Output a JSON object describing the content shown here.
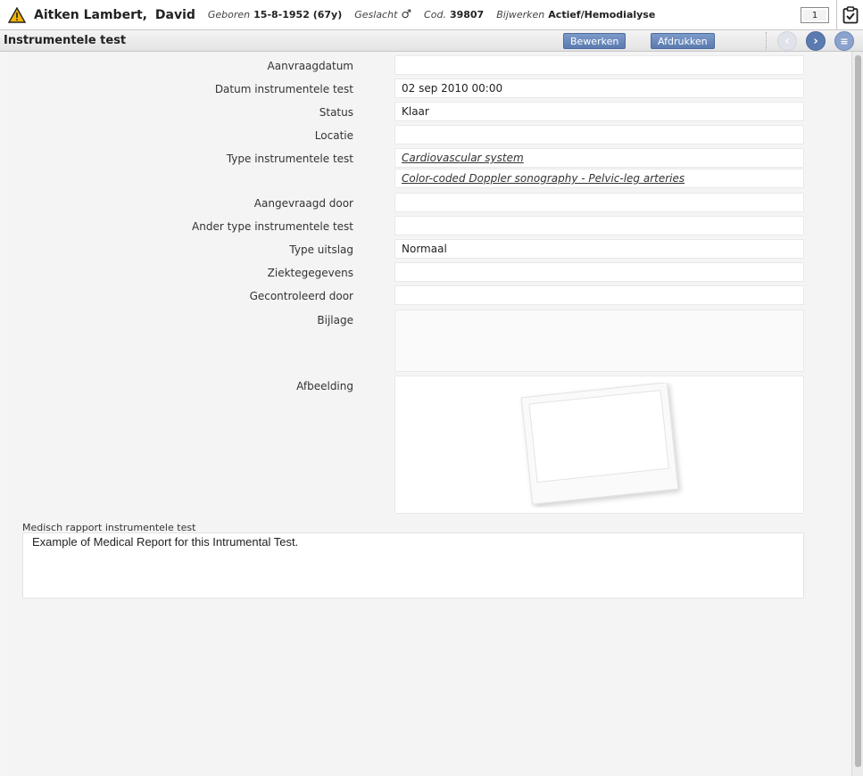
{
  "patient": {
    "lastname": "Aitken Lambert",
    "separator": ",",
    "firstname": "David",
    "born_label": "Geboren",
    "born_value": "15-8-1952 (67y)",
    "gender_label": "Geslacht",
    "gender_symbol": "♂",
    "code_label": "Cod.",
    "code_value": "39807",
    "status_label": "Bijwerken",
    "status_value": "Actief/Hemodialyse",
    "count": "1"
  },
  "toolbar": {
    "title": "Instrumentele test",
    "edit_label": "Bewerken",
    "print_label": "Afdrukken",
    "prev_icon": "‹",
    "next_icon": "›",
    "menu_icon": "≡"
  },
  "form": {
    "request_date": {
      "label": "Aanvraagdatum",
      "value": ""
    },
    "test_date": {
      "label": "Datum instrumentele test",
      "value": "02 sep 2010 00:00"
    },
    "status": {
      "label": "Status",
      "value": "Klaar"
    },
    "location": {
      "label": "Locatie",
      "value": ""
    },
    "test_type": {
      "label": "Type instrumentele test",
      "values": [
        "Cardiovascular system",
        "Color-coded Doppler sonography - Pelvic-leg arteries"
      ]
    },
    "requested_by": {
      "label": "Aangevraagd door",
      "value": ""
    },
    "other_type": {
      "label": "Ander type instrumentele test",
      "value": ""
    },
    "result_type": {
      "label": "Type uitslag",
      "value": "Normaal"
    },
    "disease_data": {
      "label": "Ziektegegevens",
      "value": ""
    },
    "checked_by": {
      "label": "Gecontroleerd door",
      "value": ""
    },
    "attachment": {
      "label": "Bijlage",
      "value": ""
    },
    "image": {
      "label": "Afbeelding"
    }
  },
  "report": {
    "label": "Medisch rapport instrumentele test",
    "text": "Example of Medical Report for this Intrumental Test."
  },
  "colors": {
    "accent_button": "#5b7bb0",
    "warning_icon": "#f2a900"
  }
}
